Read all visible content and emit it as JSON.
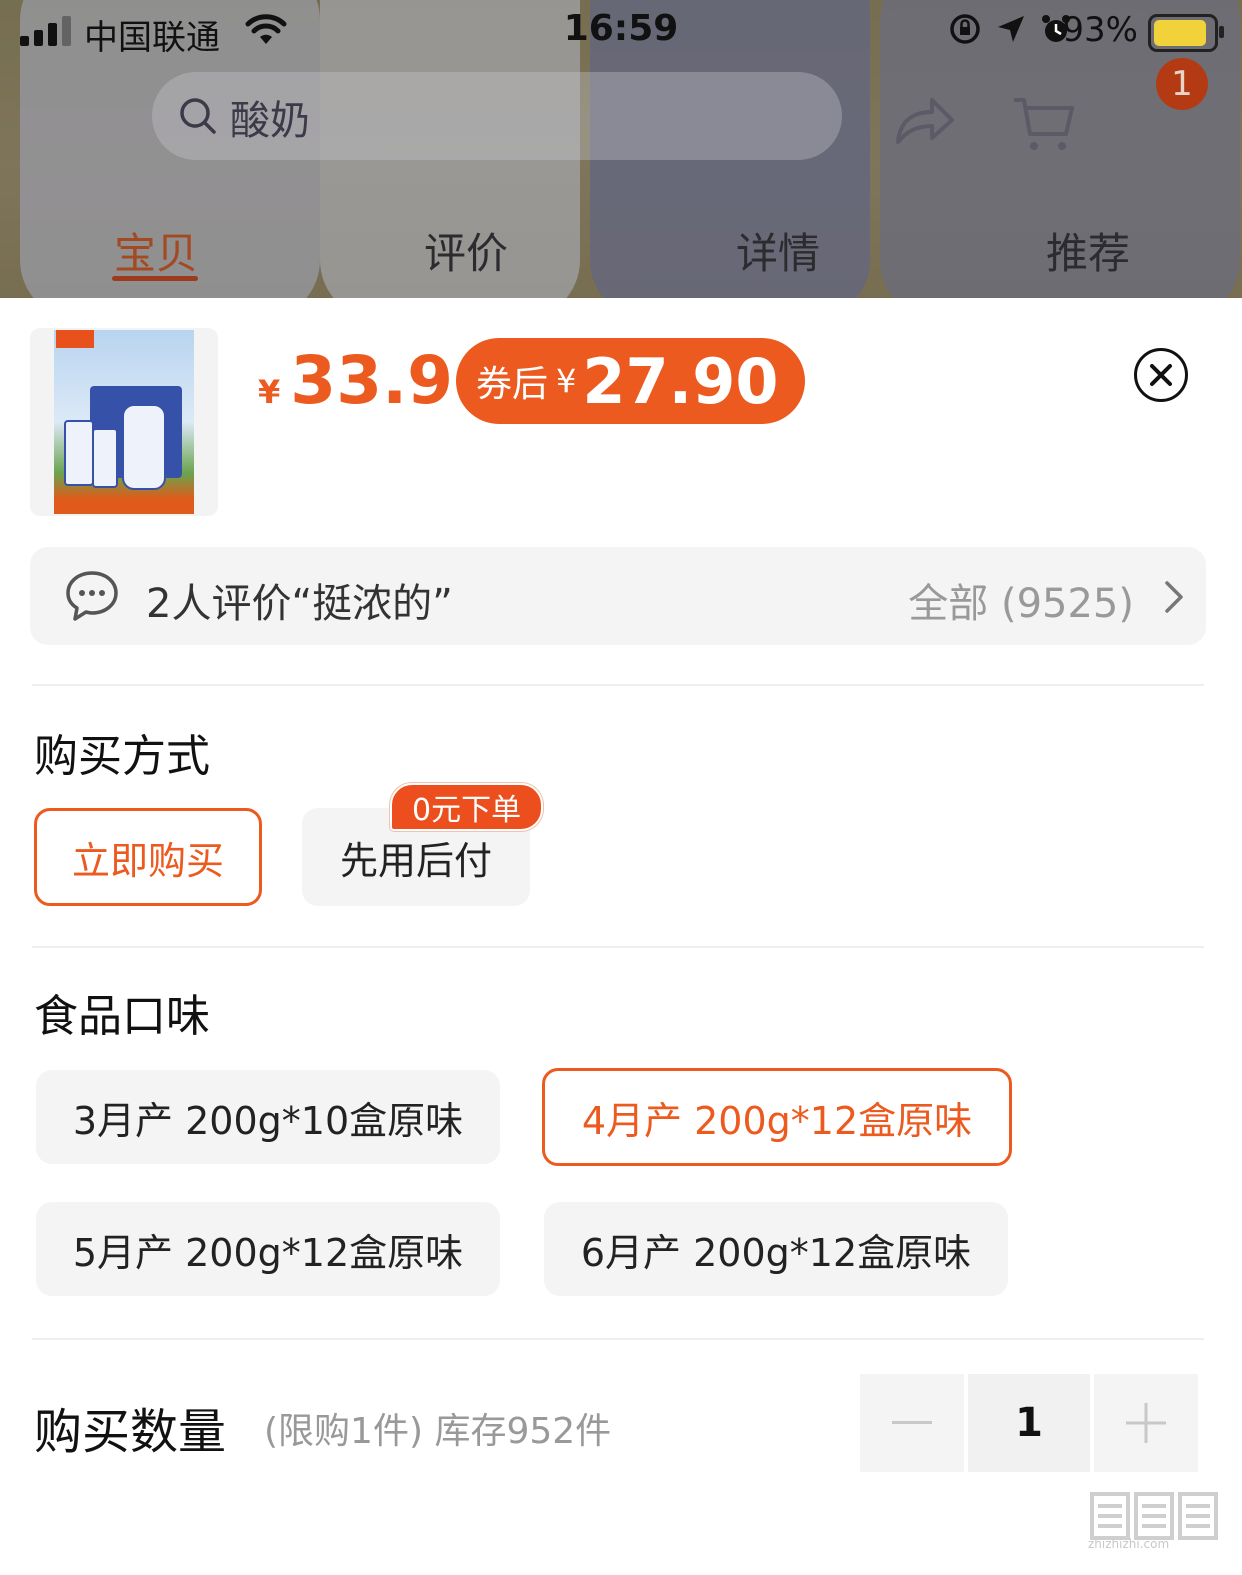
{
  "status_bar": {
    "carrier": "中国联通",
    "time": "16:59",
    "battery_percent": "93%",
    "battery_level": 0.93
  },
  "header": {
    "search_query": "酸奶",
    "cart_badge": "1"
  },
  "tabs": [
    {
      "label": "宝贝",
      "active": true
    },
    {
      "label": "评价",
      "active": false
    },
    {
      "label": "详情",
      "active": false
    },
    {
      "label": "推荐",
      "active": false
    }
  ],
  "product": {
    "currency": "¥",
    "price": "33.9",
    "coupon_label": "券后",
    "coupon_price": "27.90"
  },
  "review_bar": {
    "snippet": "2人评价“挺浓的”",
    "all_label": "全部 (9525)"
  },
  "purchase_method": {
    "title": "购买方式",
    "options": [
      {
        "label": "立即购买",
        "selected": true
      },
      {
        "label": "先用后付",
        "selected": false
      }
    ],
    "badge": "0元下单"
  },
  "flavor": {
    "title": "食品口味",
    "options": [
      {
        "label": "3月产 200g*10盒原味",
        "selected": false
      },
      {
        "label": "4月产 200g*12盒原味",
        "selected": true
      },
      {
        "label": "5月产 200g*12盒原味",
        "selected": false
      },
      {
        "label": "6月产 200g*12盒原味",
        "selected": false
      }
    ]
  },
  "quantity": {
    "title": "购买数量",
    "note": "(限购1件) 库存952件",
    "value": "1"
  },
  "colors": {
    "accent": "#ec5a1f",
    "badge": "#b33a13"
  }
}
